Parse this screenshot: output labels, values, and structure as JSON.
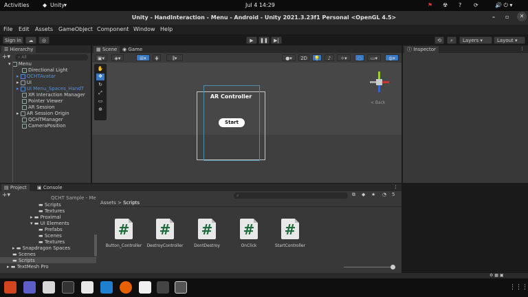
{
  "topbar": {
    "activities": "Activities",
    "app": "Unity",
    "app_arrow": "▾",
    "clock": "Jul 4  14:29",
    "indicators": "🔊 ⏻ ▾"
  },
  "titlebar": {
    "title": "Unity - HandInteraction - Menu - Android - Unity 2021.3.23f1 Personal <OpenGL 4.5>",
    "minimize": "–",
    "restore": "▫",
    "close": "✕"
  },
  "menu": [
    "File",
    "Edit",
    "Assets",
    "GameObject",
    "Component",
    "Window",
    "Help"
  ],
  "toolbar": {
    "signin": "Sign in",
    "layers": "Layers",
    "layout": "Layout"
  },
  "hierarchy": {
    "tab": "Hierarchy",
    "search_placeholder": "All",
    "root": "Menu",
    "items": [
      "Directional Light",
      "QCHTAvatar",
      "UI",
      "UI Menu_Spaces_HandT",
      "XR Interaction Manager",
      "Pointer Viewer",
      "AR Session",
      "AR Session Origin",
      "QCHTManager",
      "CameraPosition"
    ]
  },
  "scene": {
    "tab_scene": "Scene",
    "tab_game": "Game",
    "mode2d": "2D",
    "back": "< Back",
    "ar_title": "AR Controller",
    "start": "Start"
  },
  "inspector": {
    "tab": "Inspector"
  },
  "project": {
    "tab_project": "Project",
    "tab_console": "Console",
    "breadcrumb_root": "Assets",
    "breadcrumb_sep": ">",
    "breadcrumb_leaf": "Scripts",
    "count": "5",
    "tree": [
      "QCHT Sample - Me",
      "Scripts",
      "Textures",
      "Proximal",
      "UI Elements",
      "Prefabs",
      "Scenes",
      "Textures",
      "Snapdragon Spaces",
      "Scenes",
      "Scripts",
      "TextMesh Pro"
    ],
    "files": [
      "Button_Controller",
      "DestroyController",
      "DontDestroy",
      "OnClick",
      "StartController"
    ]
  },
  "colors": {
    "accent": "#3a79c4",
    "script_green": "#1d6b3a"
  }
}
